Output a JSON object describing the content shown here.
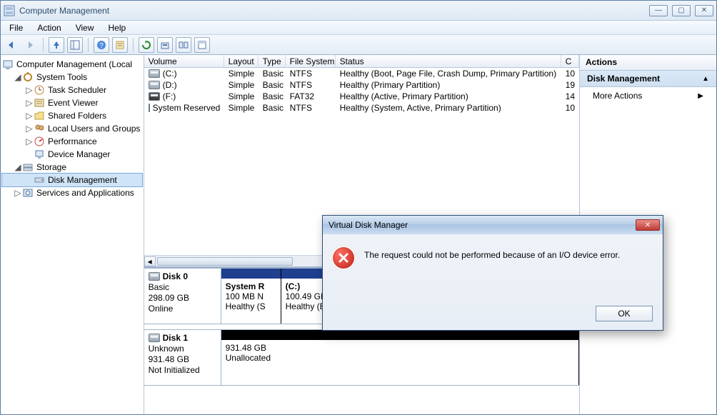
{
  "window": {
    "title": "Computer Management"
  },
  "menus": [
    "File",
    "Action",
    "View",
    "Help"
  ],
  "tree": {
    "root": "Computer Management (Local",
    "system_tools": "System Tools",
    "task_scheduler": "Task Scheduler",
    "event_viewer": "Event Viewer",
    "shared_folders": "Shared Folders",
    "local_users": "Local Users and Groups",
    "performance": "Performance",
    "device_manager": "Device Manager",
    "storage": "Storage",
    "disk_management": "Disk Management",
    "services": "Services and Applications"
  },
  "volumes": {
    "columns": [
      "Volume",
      "Layout",
      "Type",
      "File System",
      "Status",
      "C"
    ],
    "rows": [
      {
        "vol": "(C:)",
        "layout": "Simple",
        "type": "Basic",
        "fs": "NTFS",
        "status": "Healthy (Boot, Page File, Crash Dump, Primary Partition)",
        "c": "10"
      },
      {
        "vol": "(D:)",
        "layout": "Simple",
        "type": "Basic",
        "fs": "NTFS",
        "status": "Healthy (Primary Partition)",
        "c": "19"
      },
      {
        "vol": "(F:)",
        "layout": "Simple",
        "type": "Basic",
        "fs": "FAT32",
        "status": "Healthy (Active, Primary Partition)",
        "c": "14"
      },
      {
        "vol": "System Reserved",
        "layout": "Simple",
        "type": "Basic",
        "fs": "NTFS",
        "status": "Healthy (System, Active, Primary Partition)",
        "c": "10"
      }
    ]
  },
  "disks": {
    "disk0": {
      "name": "Disk 0",
      "type": "Basic",
      "size": "298.09 GB",
      "status": "Online",
      "parts": [
        {
          "label": "System R",
          "l2": "100 MB N",
          "l3": "Healthy (S"
        },
        {
          "label": "(C:)",
          "l2": "100.49 GB",
          "l3": "Healthy (B"
        }
      ]
    },
    "disk1": {
      "name": "Disk 1",
      "type": "Unknown",
      "size": "931.48 GB",
      "status": "Not Initialized",
      "unalloc_size": "931.48 GB",
      "unalloc_label": "Unallocated"
    }
  },
  "actions": {
    "header": "Actions",
    "group": "Disk Management",
    "more": "More Actions"
  },
  "dialog": {
    "title": "Virtual Disk Manager",
    "message": "The request could not be performed because of an I/O device error.",
    "ok": "OK"
  }
}
